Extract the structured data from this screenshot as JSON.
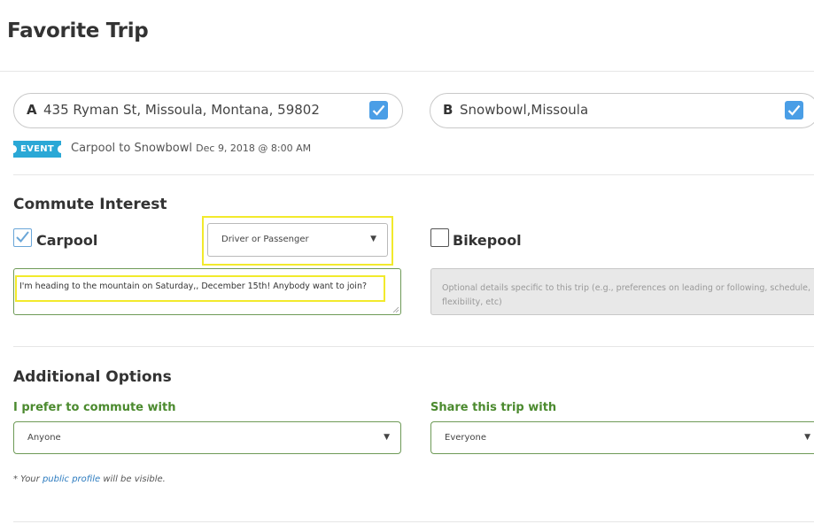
{
  "page_title": "Favorite Trip",
  "origin": {
    "letter": "A",
    "value": "435 Ryman St, Missoula, Montana, 59802",
    "checked": true
  },
  "destination": {
    "letter": "B",
    "value": "Snowbowl,Missoula",
    "checked": true
  },
  "event": {
    "badge": "EVENT",
    "name": "Carpool to Snowbowl",
    "date": "Dec 9, 2018 @ 8:00 AM"
  },
  "commute_interest": {
    "title": "Commute Interest",
    "carpool": {
      "label": "Carpool",
      "checked": true,
      "role_select": "Driver or Passenger",
      "details": "I'm heading to the mountain on Saturday,, December 15th! Anybody want to join?"
    },
    "bikepool": {
      "label": "Bikepool",
      "checked": false,
      "details_placeholder": "Optional details specific to this trip (e.g., preferences on leading or following, schedule, flexibility, etc)"
    }
  },
  "additional_options": {
    "title": "Additional Options",
    "commute_with": {
      "label": "I prefer to commute with",
      "value": "Anyone"
    },
    "share_with": {
      "label": "Share this trip with",
      "value": "Everyone"
    }
  },
  "note": {
    "prefix": "* Your ",
    "link": "public profile",
    "suffix": " will be visible."
  },
  "colors": {
    "accent_blue": "#4a9ee6",
    "event_badge": "#2aa8d6",
    "label_green": "#4b8a2e",
    "highlight_yellow": "#f2ea2c",
    "link_blue": "#2c7bbf"
  }
}
